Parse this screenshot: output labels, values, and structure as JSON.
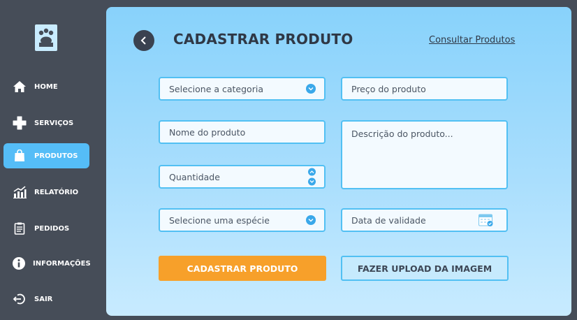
{
  "sidebar": {
    "items": [
      {
        "label": "HOME",
        "icon": "home-icon"
      },
      {
        "label": "SERVIÇOS",
        "icon": "plus-icon"
      },
      {
        "label": "PRODUTOS",
        "icon": "shopping-bag-icon",
        "active": true
      },
      {
        "label": "RELATÓRIO",
        "icon": "bar-chart-icon"
      },
      {
        "label": "PEDIDOS",
        "icon": "clipboard-icon"
      },
      {
        "label": "INFORMAÇÕES",
        "icon": "info-icon"
      },
      {
        "label": "SAIR",
        "icon": "logout-icon"
      }
    ]
  },
  "header": {
    "title": "CADASTRAR PRODUTO",
    "consult_link": "Consultar Produtos"
  },
  "form": {
    "category_placeholder": "Selecione a categoria",
    "price_placeholder": "Preço do produto",
    "name_placeholder": "Nome do produto",
    "description_placeholder": "Descrição do produto...",
    "quantity_placeholder": "Quantidade",
    "species_placeholder": "Selecione uma espécie",
    "validity_placeholder": "Data de validade"
  },
  "actions": {
    "submit_label": "CADASTRAR PRODUTO",
    "upload_label": "FAZER UPLOAD DA IMAGEM"
  },
  "colors": {
    "sidebar_bg": "#464d58",
    "accent_blue": "#55bdf7",
    "primary_orange": "#f7a02a",
    "title_dark": "#2f3846"
  }
}
